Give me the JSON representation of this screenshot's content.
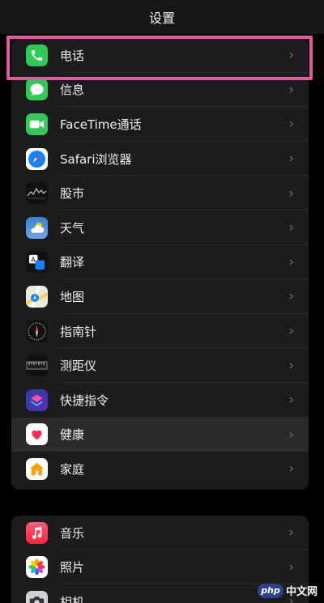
{
  "header": {
    "title": "设置"
  },
  "groups": [
    {
      "items": [
        {
          "label": "电话",
          "icon": "phone-icon"
        },
        {
          "label": "信息",
          "icon": "messages-icon"
        },
        {
          "label": "FaceTime通话",
          "icon": "facetime-icon"
        },
        {
          "label": "Safari浏览器",
          "icon": "safari-icon"
        },
        {
          "label": "股市",
          "icon": "stocks-icon"
        },
        {
          "label": "天气",
          "icon": "weather-icon"
        },
        {
          "label": "翻译",
          "icon": "translate-icon"
        },
        {
          "label": "地图",
          "icon": "maps-icon"
        },
        {
          "label": "指南针",
          "icon": "compass-icon"
        },
        {
          "label": "测距仪",
          "icon": "measure-icon"
        },
        {
          "label": "快捷指令",
          "icon": "shortcuts-icon"
        },
        {
          "label": "健康",
          "icon": "health-icon"
        },
        {
          "label": "家庭",
          "icon": "home-icon"
        }
      ]
    },
    {
      "items": [
        {
          "label": "音乐",
          "icon": "music-icon"
        },
        {
          "label": "照片",
          "icon": "photos-icon"
        },
        {
          "label": "相机",
          "icon": "camera-icon"
        }
      ]
    }
  ],
  "chevron": "›",
  "watermark": {
    "logo": "php",
    "text": "中文网"
  },
  "colors": {
    "background": "#000000",
    "group_background": "#1c1c1e",
    "highlight_border": "#e15c9a",
    "phone_green": "#34c759",
    "facetime_green": "#34c759",
    "safari_blue": "#1a82f7",
    "weather_blue": "#4a90d9",
    "music_red": "#fa3c4c"
  }
}
